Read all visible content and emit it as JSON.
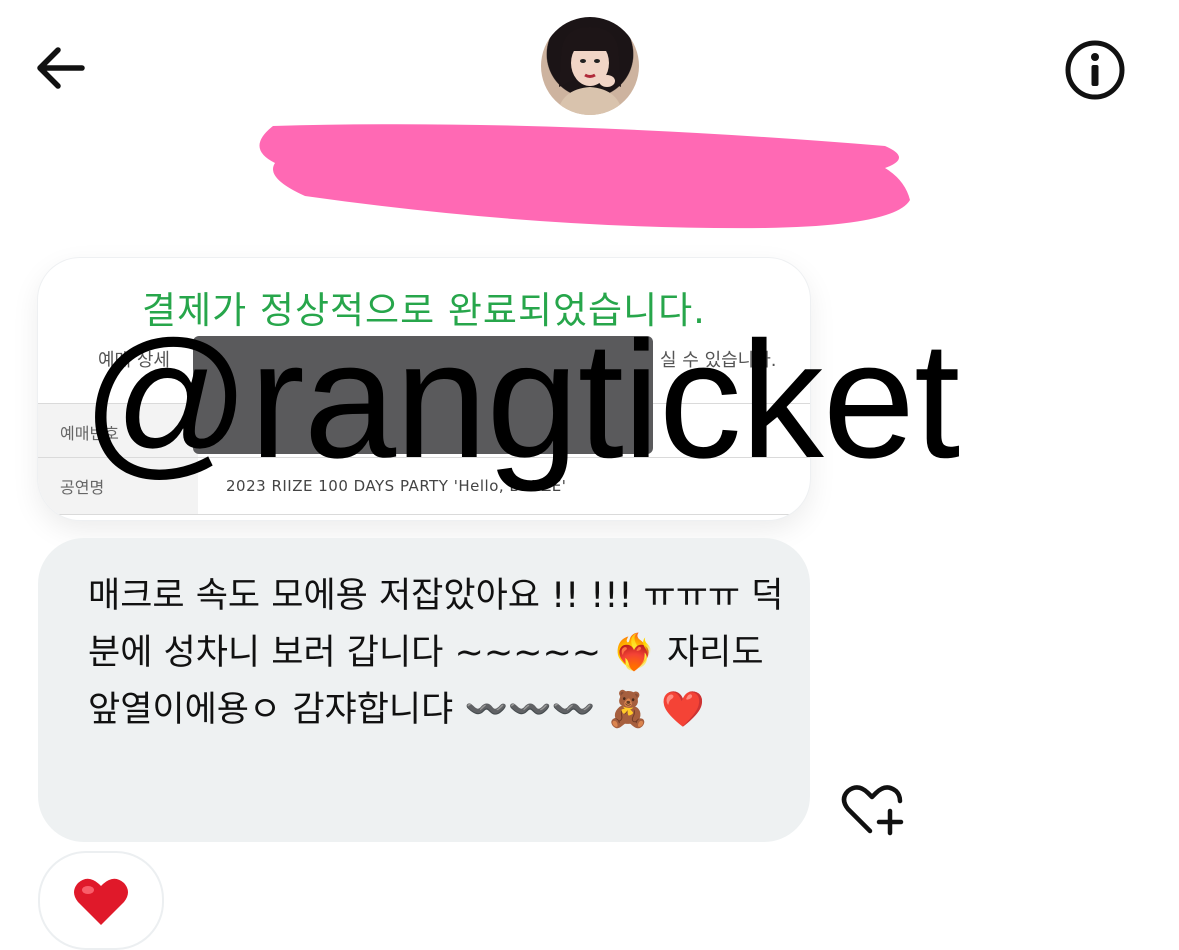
{
  "header": {
    "back_icon": "arrow-left-icon",
    "avatar": "contact-avatar",
    "info_icon": "info-circle-icon"
  },
  "receipt": {
    "title": "결제가 정상적으로 완료되었습니다.",
    "subtitle_left": "예매 상세",
    "subtitle_right": "실 수 있습니다.",
    "rows": [
      {
        "label": "예매번호",
        "value": ""
      },
      {
        "label": "공연명",
        "value": "2023 RIIZE 100 DAYS PARTY 'Hello, BRIIZE'"
      }
    ]
  },
  "watermark": "@rangticket",
  "message": {
    "text": "매크로 속도 모에용 저잡았아요 !! !!! ㅠㅠㅠ 덕분에 성차니 보러 갑니다 ~~~~~ ❤️‍🔥 자리도 앞열이에용ㅇ 감쟈합니댜 〰️〰️〰️ 🧸 ❤️"
  },
  "reactions": {
    "add_icon": "heart-plus-icon",
    "items": [
      "❤️"
    ]
  },
  "colors": {
    "redaction": "#ff69b4",
    "success_green": "#27a64b",
    "bubble_bg": "#eef1f2"
  }
}
